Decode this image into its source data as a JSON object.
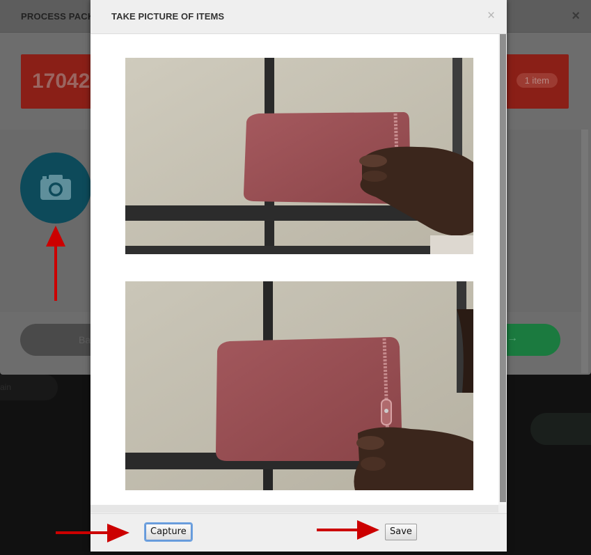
{
  "background": {
    "title": "PROCESS PACKA",
    "close_glyph": "×",
    "order_number": "17042",
    "item_count": "1 item",
    "back_label": "Ba",
    "next_arrow": "→",
    "side_pill": "ain",
    "camera_icon": "camera-icon",
    "colors": {
      "banner": "#c0392b",
      "camera_button": "#167a92",
      "next_button": "#27ae60"
    }
  },
  "dialog": {
    "title": "TAKE PICTURE OF ITEMS",
    "close_glyph": "×",
    "photos": [
      {
        "name": "live-camera-preview"
      },
      {
        "name": "captured-photo"
      }
    ],
    "footer": {
      "capture_label": "Capture",
      "save_label": "Save"
    }
  },
  "annotations": {
    "arrow_color": "#cc0000",
    "arrows": [
      "arrow-to-camera-button",
      "arrow-to-capture-button",
      "arrow-to-save-button"
    ]
  }
}
